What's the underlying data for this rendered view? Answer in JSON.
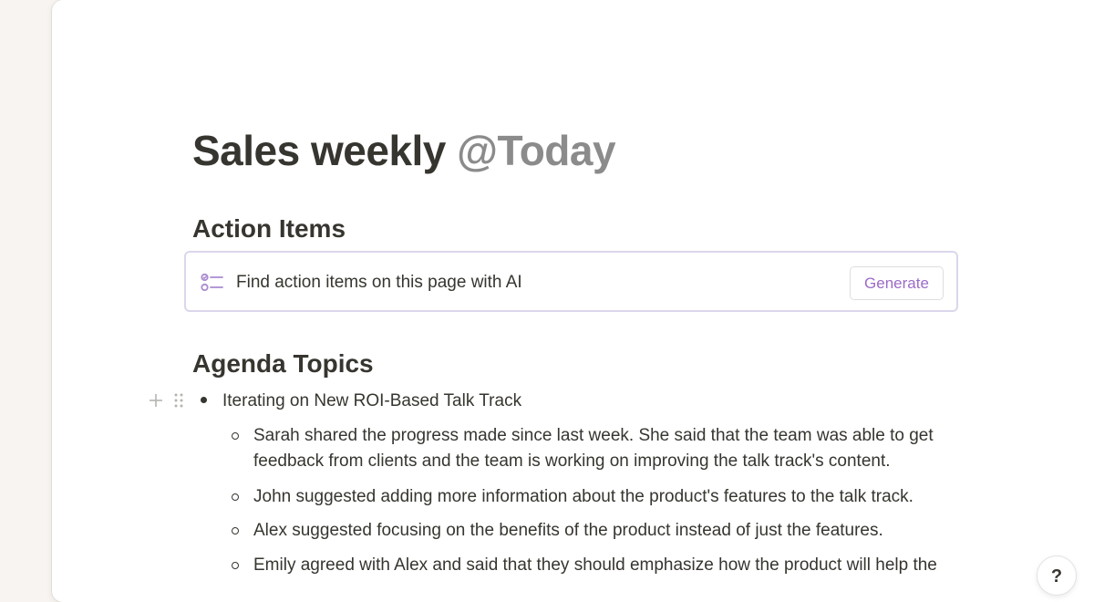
{
  "page": {
    "title": "Sales weekly",
    "title_mention": "@Today"
  },
  "action_items": {
    "heading": "Action Items",
    "ai_prompt": "Find action items on this page with AI",
    "generate_label": "Generate",
    "icon": "checklist-icon"
  },
  "agenda": {
    "heading": "Agenda Topics",
    "items": [
      {
        "text": "Iterating on New ROI-Based Talk Track",
        "children": [
          "Sarah shared the progress made since last week. She said that the team was able to get feedback from clients and the team is working on improving the talk track's content.",
          "John suggested adding more information about the product's features to the talk track.",
          "Alex suggested focusing on the benefits of the product instead of just the features.",
          "Emily agreed with Alex and said that they should emphasize how the product will help the"
        ]
      }
    ]
  },
  "help": {
    "label": "?"
  },
  "colors": {
    "text": "#37352f",
    "mention": "#8b8b8b",
    "accent": "#9b6bc8",
    "ai_border": "#dcd6ec",
    "background": "#f8f4f1"
  }
}
